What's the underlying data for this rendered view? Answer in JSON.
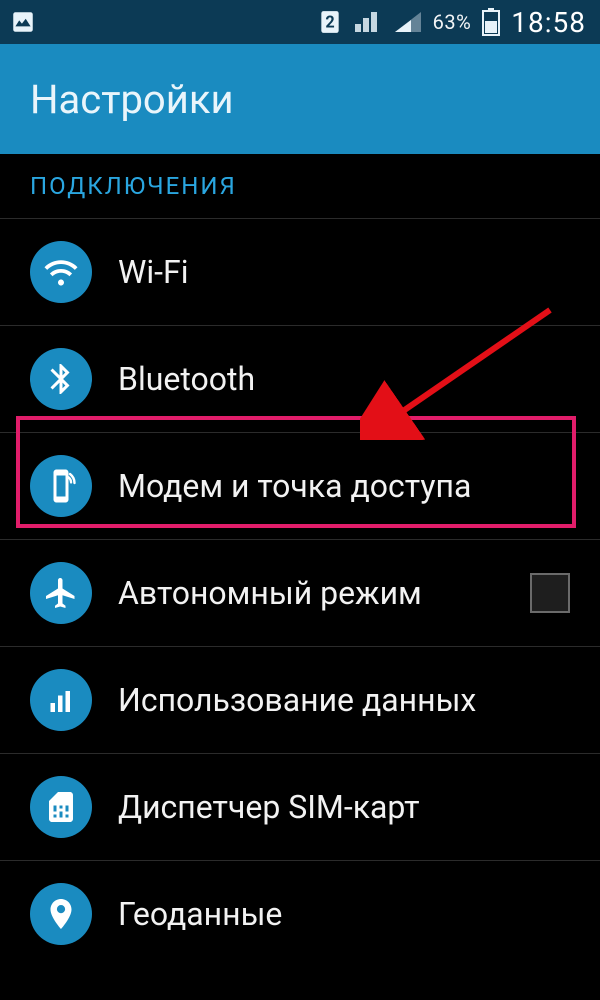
{
  "status": {
    "battery_pct": "63%",
    "clock": "18:58",
    "sim_slot": "2"
  },
  "title": "Настройки",
  "section": "ПОДКЛЮЧЕНИЯ",
  "items": {
    "wifi": "Wi-Fi",
    "bluetooth": "Bluetooth",
    "tethering": "Модем и точка доступа",
    "airplane": "Автономный режим",
    "datausage": "Использование данных",
    "sim": "Диспетчер SIM-карт",
    "location": "Геоданные"
  }
}
